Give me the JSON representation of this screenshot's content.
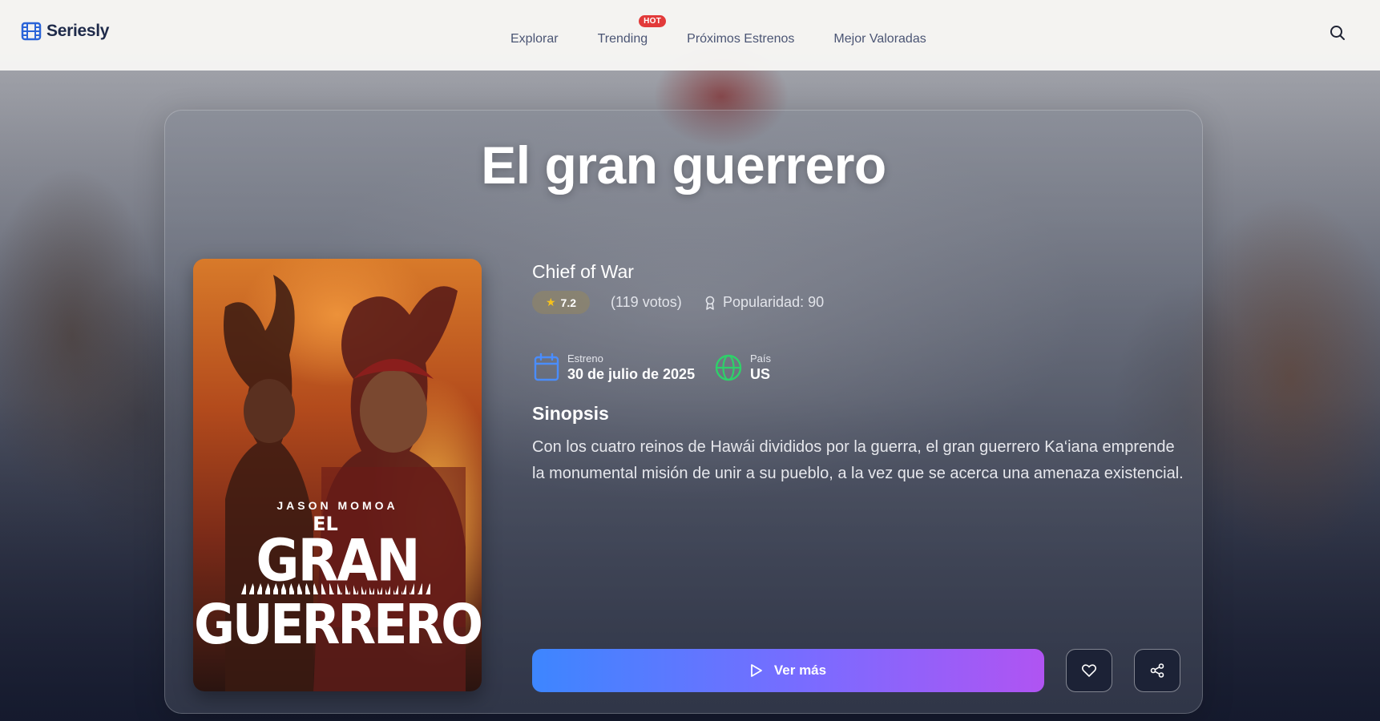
{
  "app": {
    "name": "Seriesly"
  },
  "nav": {
    "items": [
      {
        "label": "Explorar"
      },
      {
        "label": "Trending",
        "badge": "HOT"
      },
      {
        "label": "Próximos Estrenos"
      },
      {
        "label": "Mejor Valoradas"
      }
    ],
    "search_icon": "search-icon"
  },
  "show": {
    "title": "El gran guerrero",
    "original_title": "Chief of War",
    "rating": "7.2",
    "votes": "(119 votos)",
    "popularity": "Popularidad: 90",
    "release": {
      "label": "Estreno",
      "value": "30 de julio de 2025"
    },
    "country": {
      "label": "País",
      "value": "US"
    },
    "synopsis_heading": "Sinopsis",
    "synopsis": "Con los cuatro reinos de Hawái divididos por la guerra, el gran guerrero Ka‘iana emprende la monumental misión de unir a su pueblo, a la vez que se acerca una amenaza existencial.",
    "poster": {
      "actor": "JASON MOMOA",
      "line1": "EL",
      "line2": "GRAN",
      "line3": "GUERRERO"
    }
  },
  "actions": {
    "primary_label": "Ver más",
    "favorite_icon": "heart-icon",
    "share_icon": "share-icon"
  },
  "colors": {
    "accent_start": "#3d86ff",
    "accent_end": "#b054f2",
    "hot_badge": "#e23a3a",
    "star": "#f7c21b",
    "calendar_icon": "#4a8dff",
    "globe_icon": "#2fd06a"
  }
}
